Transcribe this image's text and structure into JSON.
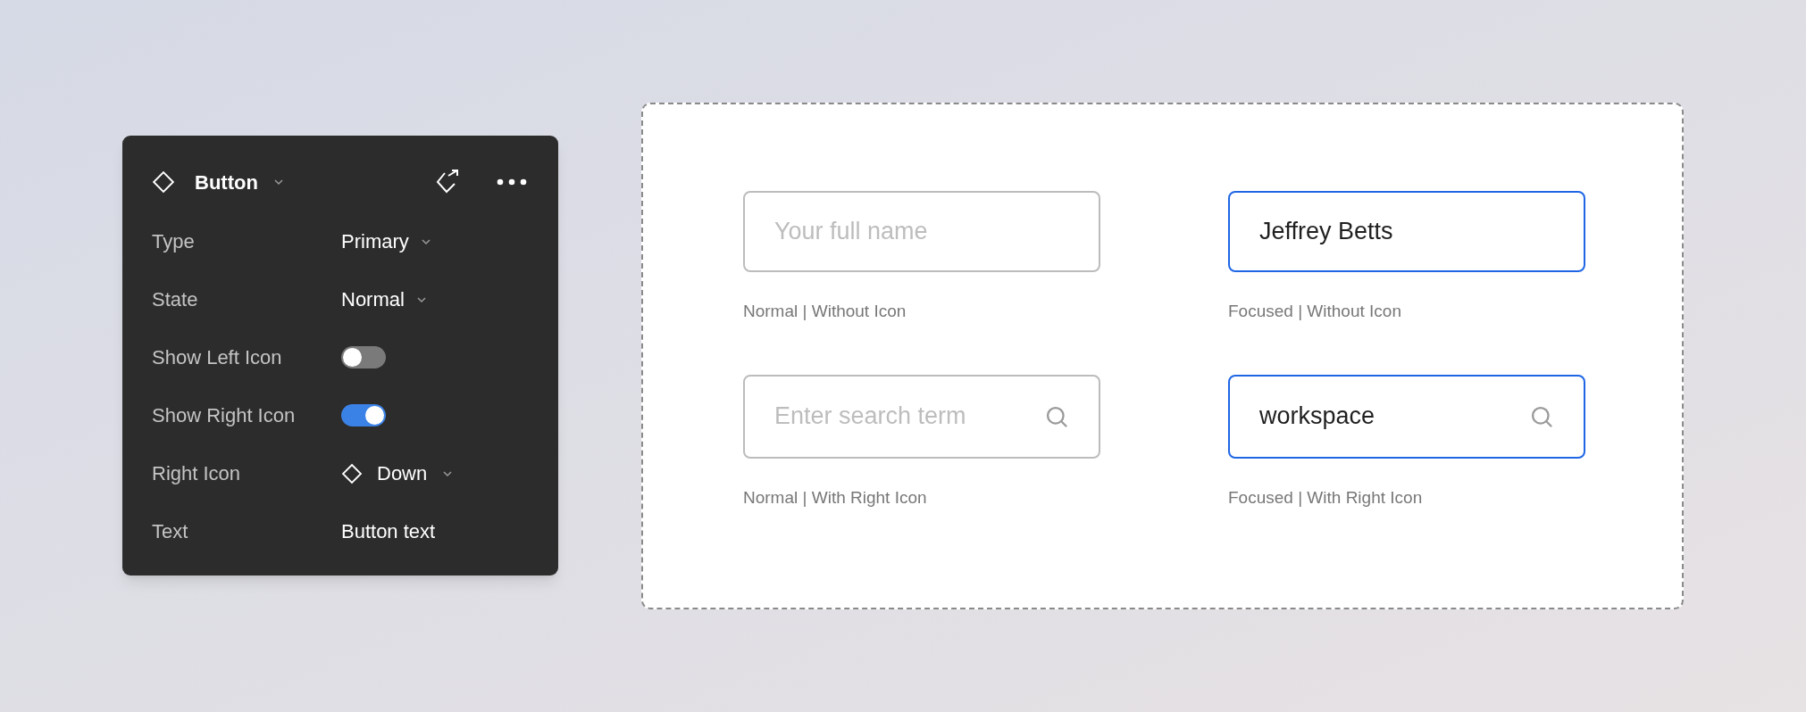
{
  "panel": {
    "title": "Button",
    "properties": [
      {
        "kind": "dropdown",
        "label": "Type",
        "value": "Primary"
      },
      {
        "kind": "dropdown",
        "label": "State",
        "value": "Normal"
      },
      {
        "kind": "toggle",
        "label": "Show Left Icon",
        "on": false
      },
      {
        "kind": "toggle",
        "label": "Show Right Icon",
        "on": true
      },
      {
        "kind": "icon-dropdown",
        "label": "Right Icon",
        "value": "Down"
      },
      {
        "kind": "text",
        "label": "Text",
        "value": "Button text"
      }
    ]
  },
  "fields": [
    {
      "placeholder": "Your full name",
      "focused": false,
      "search_icon": false,
      "caption": "Normal | Without Icon"
    },
    {
      "value": "Jeffrey Betts",
      "focused": true,
      "search_icon": false,
      "caption": "Focused | Without Icon"
    },
    {
      "placeholder": "Enter search term",
      "focused": false,
      "search_icon": true,
      "caption": "Normal | With Right Icon"
    },
    {
      "value": "workspace",
      "focused": true,
      "search_icon": true,
      "caption": "Focused | With Right Icon"
    }
  ]
}
